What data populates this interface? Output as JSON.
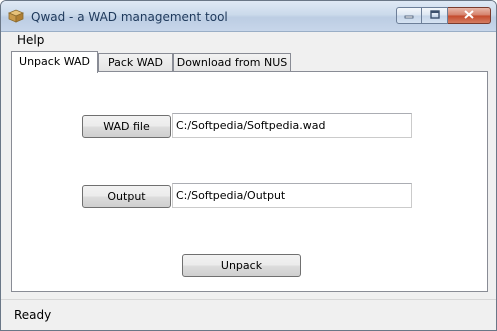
{
  "window": {
    "title": "Qwad - a WAD management tool"
  },
  "menu": {
    "help": "Help"
  },
  "tabs": [
    {
      "label": "Unpack WAD",
      "active": true
    },
    {
      "label": "Pack WAD",
      "active": false
    },
    {
      "label": "Download from NUS",
      "active": false
    }
  ],
  "unpack": {
    "wad_button": "WAD file",
    "wad_path": "C:/Softpedia/Softpedia.wad",
    "output_button": "Output",
    "output_path": "C:/Softpedia/Output",
    "unpack_button": "Unpack"
  },
  "status": {
    "text": "Ready"
  },
  "icons": {
    "app": "box-icon",
    "minimize": "minimize-icon",
    "maximize": "maximize-icon",
    "close": "close-icon"
  },
  "colors": {
    "close_button": "#c4492b",
    "titlebar": "#cbdaeb"
  }
}
